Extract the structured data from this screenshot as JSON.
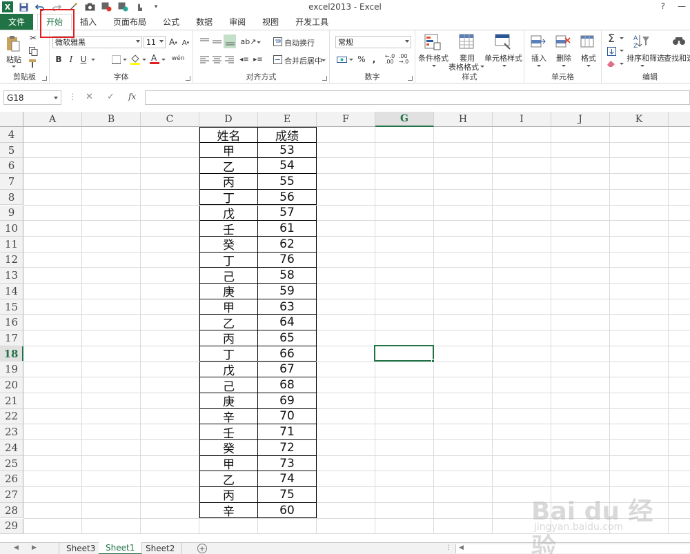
{
  "window": {
    "title": "excel2013 - Excel",
    "help": "?",
    "minimize": "—",
    "close": "×"
  },
  "tabs": [
    "文件",
    "开始",
    "插入",
    "页面布局",
    "公式",
    "数据",
    "审阅",
    "视图",
    "开发工具"
  ],
  "active_tab": "开始",
  "ribbon": {
    "clipboard": {
      "paste": "粘贴",
      "label": "剪贴板"
    },
    "font": {
      "name": "微软雅黑",
      "size": "11",
      "bold": "B",
      "italic": "I",
      "underline": "U",
      "grow": "A",
      "shrink": "A",
      "label": "字体"
    },
    "alignment": {
      "wrap_text": "自动换行",
      "merge_center": "合并后居中",
      "label": "对齐方式"
    },
    "number": {
      "format": "常规",
      "percent": "%",
      "comma": ",",
      "label": "数字"
    },
    "styles": {
      "conditional": "条件格式",
      "table_format_1": "套用",
      "table_format_2": "表格格式",
      "cell_styles": "单元格样式",
      "label": "样式"
    },
    "cells": {
      "insert": "插入",
      "delete": "删除",
      "format": "格式",
      "label": "单元格"
    },
    "editing": {
      "sort_filter": "排序和筛选",
      "find_select": "查找和选",
      "sum": "Σ",
      "label": "编辑"
    }
  },
  "formula_bar": {
    "name_box": "G18",
    "fx": "fx",
    "cancel": "✕",
    "enter": "✓",
    "sep": "⋮",
    "formula": ""
  },
  "grid": {
    "columns": [
      "A",
      "B",
      "C",
      "D",
      "E",
      "F",
      "G",
      "H",
      "I",
      "J",
      "K"
    ],
    "selected_column": "G",
    "first_row": 4,
    "rows": [
      "4",
      "5",
      "6",
      "7",
      "8",
      "9",
      "10",
      "11",
      "12",
      "13",
      "14",
      "15",
      "16",
      "17",
      "18",
      "19",
      "20",
      "21",
      "22",
      "23",
      "24",
      "25",
      "26",
      "27",
      "28",
      "29"
    ],
    "selected_row": "18",
    "selected_cell": "G18",
    "table": {
      "header": [
        "姓名",
        "成绩"
      ],
      "records": [
        [
          "甲",
          "53"
        ],
        [
          "乙",
          "54"
        ],
        [
          "丙",
          "55"
        ],
        [
          "丁",
          "56"
        ],
        [
          "戊",
          "57"
        ],
        [
          "壬",
          "61"
        ],
        [
          "癸",
          "62"
        ],
        [
          "丁",
          "76"
        ],
        [
          "己",
          "58"
        ],
        [
          "庚",
          "59"
        ],
        [
          "甲",
          "63"
        ],
        [
          "乙",
          "64"
        ],
        [
          "丙",
          "65"
        ],
        [
          "丁",
          "66"
        ],
        [
          "戊",
          "67"
        ],
        [
          "己",
          "68"
        ],
        [
          "庚",
          "69"
        ],
        [
          "辛",
          "70"
        ],
        [
          "壬",
          "71"
        ],
        [
          "癸",
          "72"
        ],
        [
          "甲",
          "73"
        ],
        [
          "乙",
          "74"
        ],
        [
          "丙",
          "75"
        ],
        [
          "辛",
          "60"
        ]
      ]
    }
  },
  "sheets": [
    "Sheet3",
    "Sheet1",
    "Sheet2"
  ],
  "active_sheet": "Sheet1",
  "add_sheet": "+",
  "watermark": {
    "logo": "Bai du 经验",
    "url": "jingyan.baidu.com"
  },
  "colors": {
    "excel_green": "#217346",
    "highlight_red": "#e02020"
  }
}
